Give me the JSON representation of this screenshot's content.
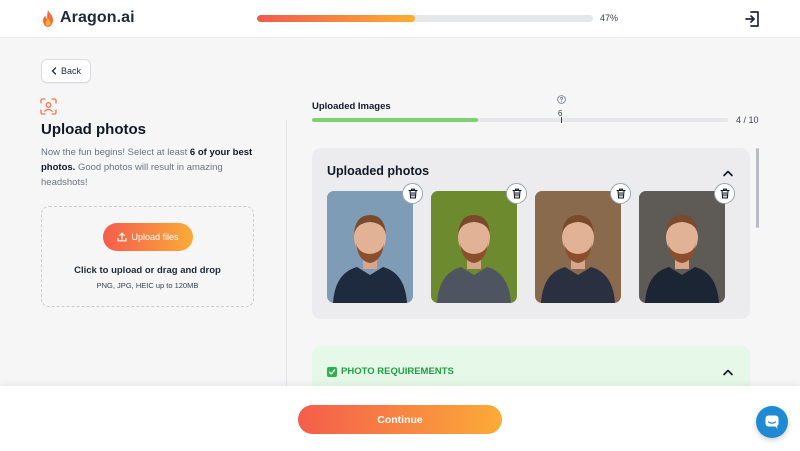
{
  "app": {
    "name": "Aragon.ai"
  },
  "header": {
    "progress_percent": 47,
    "progress_label": "47%"
  },
  "back": {
    "label": "Back"
  },
  "upload_panel": {
    "title": "Upload photos",
    "description_before": "Now the fun begins! Select at least ",
    "description_bold": "6 of your best photos.",
    "description_after": " Good photos will result in amazing headshots!",
    "button_label": "Upload files",
    "drop_text": "Click to upload or drag and drop",
    "formats_text": "PNG, JPG, HEIC up to 120MB"
  },
  "uploaded_images": {
    "label": "Uploaded Images",
    "minimum_marker": "6",
    "count_label": "4 / 10",
    "uploaded": 4,
    "max": 10
  },
  "photos_section": {
    "title": "Uploaded photos",
    "photos": [
      {
        "background": "#7f9cb6",
        "shirt": "#1e2a3d"
      },
      {
        "background": "#6e8a2f",
        "shirt": "#4e5560"
      },
      {
        "background": "#8a6a4d",
        "shirt": "#2a3040"
      },
      {
        "background": "#5e5a55",
        "shirt": "#1c2533"
      }
    ]
  },
  "requirements": {
    "title": "PHOTO REQUIREMENTS"
  },
  "footer": {
    "continue_label": "Continue"
  },
  "colors": {
    "accent_start": "#f45d4c",
    "accent_end": "#fbab37",
    "progress_green": "#7dd06f",
    "requirements_green": "#22a043",
    "chat_blue": "#1f8ad3"
  }
}
